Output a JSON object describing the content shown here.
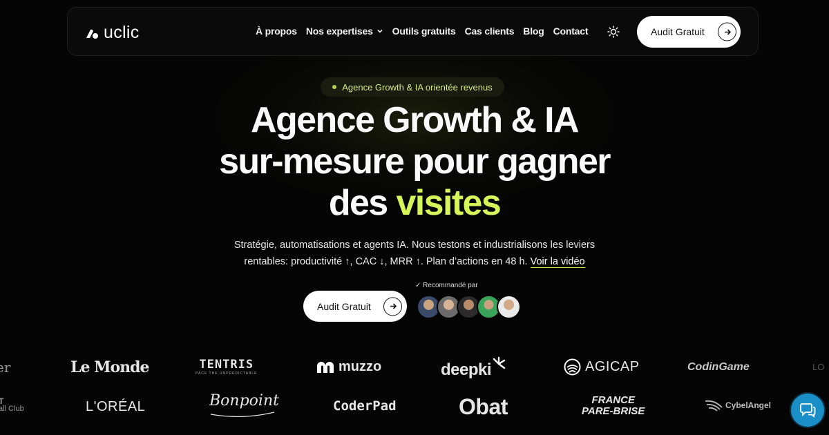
{
  "nav": {
    "logo_text": "uclic",
    "items": [
      {
        "label": "À propos"
      },
      {
        "label": "Nos expertises",
        "has_dropdown": true
      },
      {
        "label": "Outils gratuits"
      },
      {
        "label": "Cas clients"
      },
      {
        "label": "Blog"
      },
      {
        "label": "Contact"
      }
    ],
    "cta_label": "Audit Gratuit"
  },
  "hero": {
    "badge": "Agence Growth & IA orientée revenus",
    "headline_line1": "Agence Growth & IA",
    "headline_line2": "sur-mesure pour gagner",
    "headline_line3_prefix": "des",
    "headline_accent": "visites",
    "subtext_line1": "Stratégie, automatisations et agents IA. Nous testons et industrialisons les leviers",
    "subtext_line2": "rentables: productivité ↑, CAC ↓, MRR ↑. Plan d’actions en 48 h.",
    "video_link": "Voir la vidéo",
    "cta_label": "Audit Gratuit",
    "recommended": "✓ Recommandé par"
  },
  "logos_row1": [
    "er",
    "Le Monde",
    "TENTRIS",
    "muzzo",
    "deepki",
    "AGICAP",
    "CodinGame",
    "LO"
  ],
  "logos_row2": [
    "T",
    "all Club",
    "L'ORÉAL",
    "Bonpoint",
    "CoderPad",
    "Obat",
    "FRANCE",
    "PARE-BRISE",
    "CybelAngel"
  ],
  "tentris_tagline": "PACE THE UNPREDICTABLE",
  "colors": {
    "background": "#050505",
    "accent": "#d6f55a",
    "badge_bg": "#1a1c10",
    "chat": "#1a8fc7"
  },
  "icons": {
    "theme_toggle": "sun-icon",
    "cta_arrow": "arrow-right-icon",
    "chat": "chat-bubble-icon",
    "dropdown": "chevron-down-icon"
  }
}
